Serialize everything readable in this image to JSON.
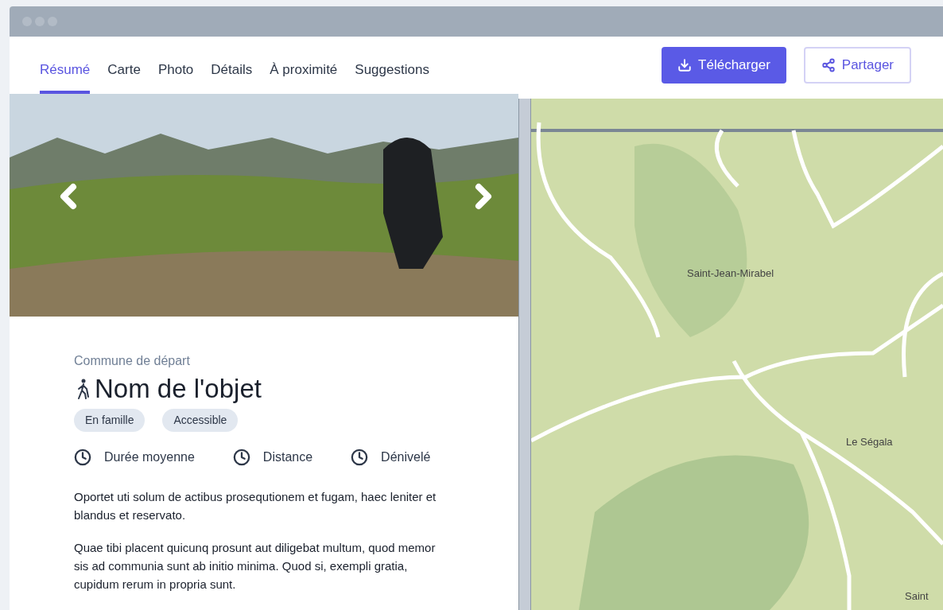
{
  "tabs": [
    {
      "label": "Résumé",
      "selected": true
    },
    {
      "label": "Carte",
      "selected": false
    },
    {
      "label": "Photo",
      "selected": false
    },
    {
      "label": "Détails",
      "selected": false
    },
    {
      "label": "À proximité",
      "selected": false
    },
    {
      "label": "Suggestions",
      "selected": false
    }
  ],
  "actions": [
    {
      "label": "Télécharger",
      "kind": "primary"
    },
    {
      "label": "Partager",
      "kind": "outline"
    }
  ],
  "detail": {
    "commune": "Commune de départ",
    "title": "Nom de l'objet",
    "tags": [
      "En famille",
      "Accessible"
    ],
    "facts": [
      "Durée moyenne",
      "Distance",
      "Dénivelé"
    ],
    "paragraphs": [
      "Oportet uti solum de actibus prosequtionem et fugam, haec leniter et blandus et reservato.",
      "Quae tibi placent quicunq prosunt aut diligebat multum, quod memor sis ad communia sunt ab initio minima. Quod si, exempli gratia, cupidum rerum in propria sunt."
    ]
  },
  "map": {
    "labels": [
      "Saint-Jean-Mirabel",
      "Le Ségala",
      "Saint"
    ]
  }
}
